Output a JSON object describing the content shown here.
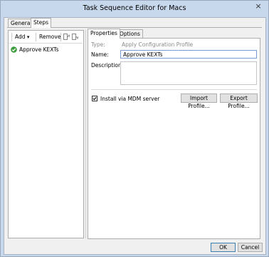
{
  "window": {
    "title": "Task Sequence Editor for Macs",
    "close_symbol": "×"
  },
  "main_tabs": [
    {
      "label": "General"
    },
    {
      "label": "Steps"
    }
  ],
  "toolbar": {
    "add_label": "Add",
    "add_arrow": "▾",
    "remove_label": "Remove",
    "move_up_icon": "move-up-icon",
    "move_down_icon": "move-down-icon"
  },
  "steps": [
    {
      "label": "Approve KEXTs",
      "status_icon": "check-icon",
      "status_color": "#3a9b3a"
    }
  ],
  "detail_tabs": [
    {
      "label": "Properties"
    },
    {
      "label": "Options"
    }
  ],
  "properties": {
    "type_label": "Type:",
    "type_value": "Apply Configuration Profile",
    "name_label": "Name:",
    "name_value": "Approve KEXTs",
    "description_label": "Description:",
    "description_value": "",
    "install_mdm_label": "Install via MDM server",
    "install_mdm_checked": true,
    "import_button": "Import Profile...",
    "export_button": "Export Profile..."
  },
  "footer": {
    "ok_label": "OK",
    "cancel_label": "Cancel"
  },
  "colors": {
    "titlebar": "#c8d8ec",
    "accent_border": "#7a9cd3",
    "check_green": "#3a9b3a"
  }
}
